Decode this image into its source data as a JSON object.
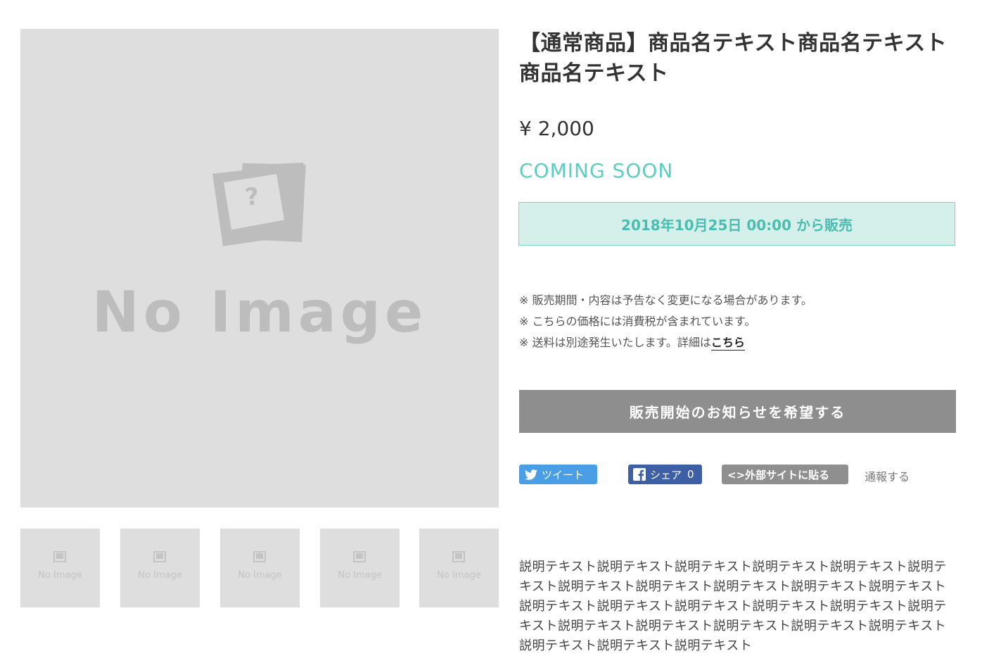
{
  "product": {
    "main_image": {
      "placeholder_icon": "polaroid-question-icon",
      "placeholder_text": "No Image"
    },
    "thumbnails": [
      {
        "placeholder_text": "No Image"
      },
      {
        "placeholder_text": "No Image"
      },
      {
        "placeholder_text": "No Image"
      },
      {
        "placeholder_text": "No Image"
      },
      {
        "placeholder_text": "No Image"
      }
    ],
    "title": "【通常商品】商品名テキスト商品名テキスト商品名テキスト",
    "price": "¥ 2,000",
    "status": "COMING SOON",
    "sale_start": "2018年10月25日 00:00 から販売",
    "notes": {
      "line1": "※ 販売期間・内容は予告なく変更になる場合があります。",
      "line2": "※ こちらの価格には消費税が含まれています。",
      "line3_prefix": "※ 送料は別途発生いたします。詳細は",
      "line3_link": "こちら"
    },
    "notify_button": "販売開始のお知らせを希望する",
    "social": {
      "tweet": "ツイート",
      "share": "シェア",
      "share_count": "0",
      "embed": "<>外部サイトに貼る",
      "report": "通報する"
    },
    "description": "説明テキスト説明テキスト説明テキスト説明テキスト説明テキスト説明テキスト説明テキスト説明テキスト説明テキスト説明テキスト説明テキスト説明テキスト説明テキスト説明テキスト説明テキスト説明テキスト説明テキスト説明テキスト説明テキスト説明テキスト説明テキスト説明テキスト説明テキスト説明テキスト説明テキスト"
  },
  "colors": {
    "accent": "#5ccdc0",
    "sale_box_bg": "#d5efeb",
    "button_gray": "#8e8e8e",
    "twitter": "#4a9ee5",
    "facebook": "#3c5fa6",
    "placeholder_bg": "#dedede"
  }
}
